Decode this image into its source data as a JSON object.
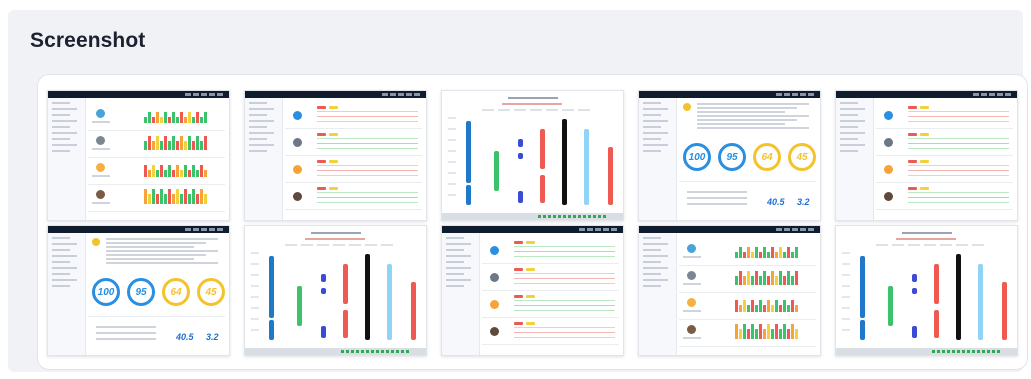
{
  "section": {
    "title": "Screenshot"
  },
  "thumbnails": [
    {
      "kind": "dashboard-bars"
    },
    {
      "kind": "dashboard-list"
    },
    {
      "kind": "leaderboard-bars"
    },
    {
      "kind": "scores-rings",
      "scores": [
        "100",
        "95",
        "64",
        "45"
      ],
      "metrics": [
        "40.5",
        "3.2"
      ]
    },
    {
      "kind": "dashboard-list"
    },
    {
      "kind": "scores-rings",
      "scores": [
        "100",
        "95",
        "64",
        "45"
      ],
      "metrics": [
        "40.5",
        "3.2"
      ]
    },
    {
      "kind": "leaderboard-bars"
    },
    {
      "kind": "dashboard-list"
    },
    {
      "kind": "dashboard-bars"
    },
    {
      "kind": "leaderboard-bars"
    }
  ],
  "colors": {
    "topbar": "#0f1c2e",
    "ring_blue": "#2a8fe0",
    "ring_yellow": "#f3c32c",
    "bar_green": "#3cc26b",
    "bar_red": "#ee5a52",
    "bar_orange": "#f6a33a",
    "bar_yellow": "#f3d13a"
  }
}
